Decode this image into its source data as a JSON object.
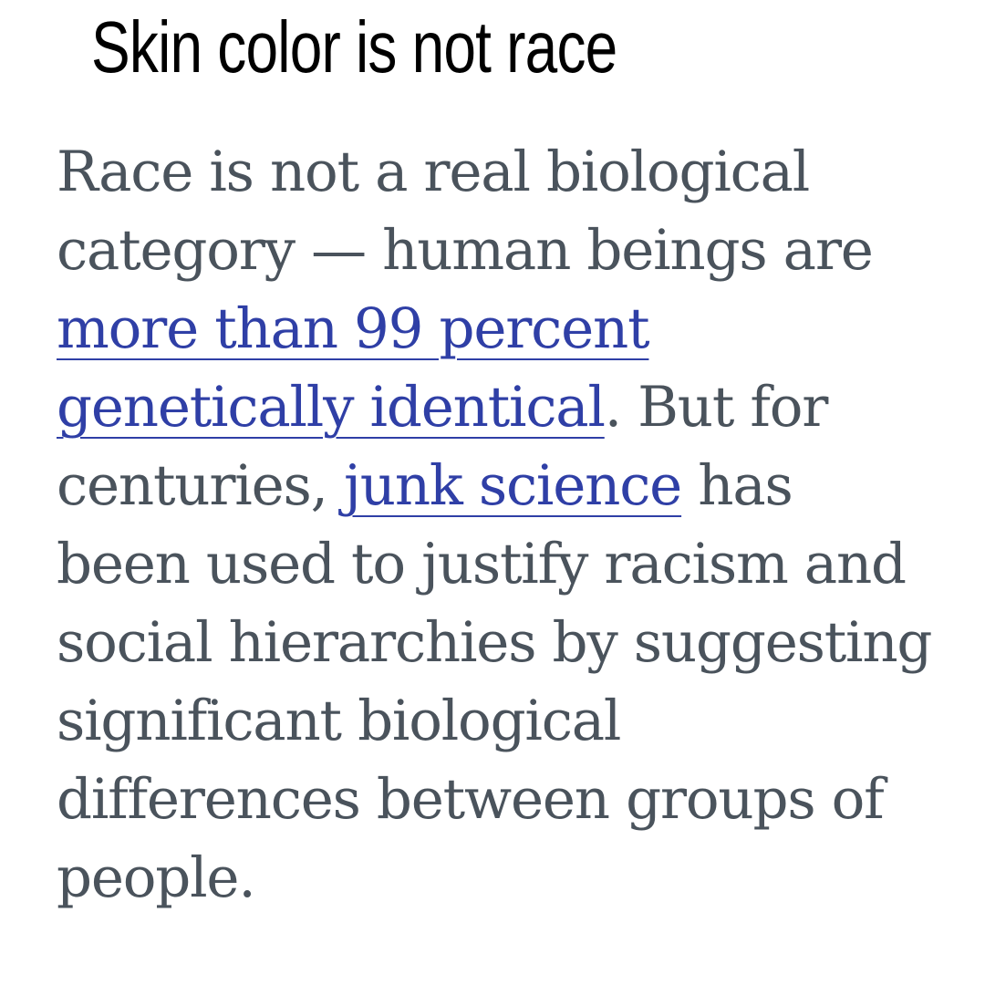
{
  "article": {
    "heading": "Skin color is not race",
    "paragraph": {
      "line_1": "Race is not a real biological",
      "line_2": "category — human beings are",
      "link_genetic_part_1": "more than 99 percent",
      "link_genetic_part_2": "genetically identical",
      "after_link_genetic": ". But for",
      "before_link_junk": "centuries, ",
      "link_junk": "junk science",
      "after_link_junk": " has",
      "line_6": "been used to justify racism and",
      "line_7": "social hierarchies by suggesting",
      "line_8": "significant biological",
      "line_9": "differences between groups of",
      "line_10": "people."
    }
  },
  "colors": {
    "heading": "#000000",
    "body_text": "#4a535c",
    "link": "#2f3fa6",
    "background": "#ffffff"
  }
}
